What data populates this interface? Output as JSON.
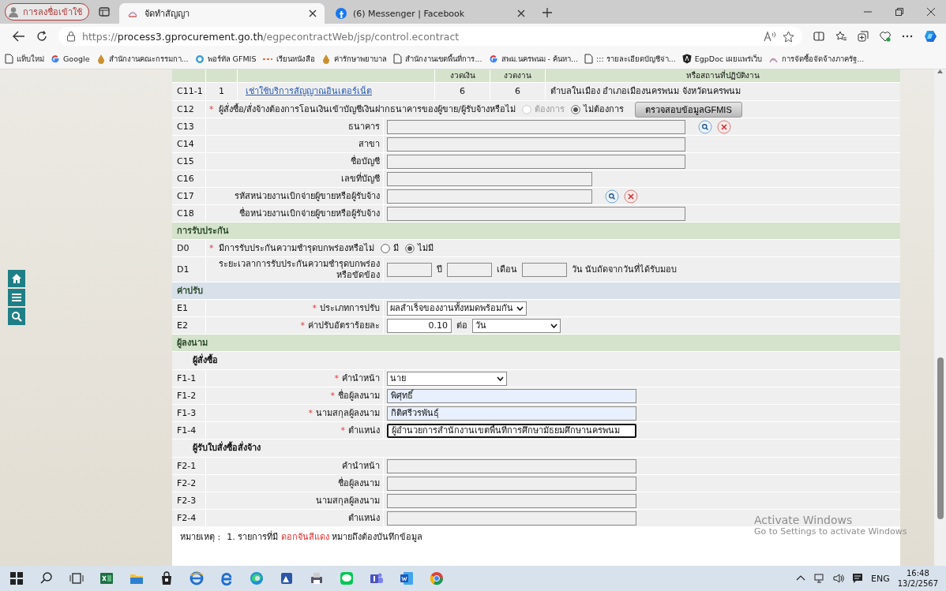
{
  "browser": {
    "profile_button": "การลงชื่อเข้าใช้",
    "tabs": [
      {
        "title": "จัดทำสัญญา",
        "selected": true,
        "kind": "site"
      },
      {
        "title": "(6) Messenger | Facebook",
        "selected": false,
        "kind": "social"
      }
    ],
    "url": {
      "scheme": "https://",
      "host": "process3.gprocurement.go.th",
      "path": "/egpecontractWeb/jsp/control.econtract"
    },
    "bookmarks": [
      {
        "label": "แท็บใหม่",
        "kind": "page"
      },
      {
        "label": "Google",
        "kind": "google"
      },
      {
        "label": "สำนักงานคณะกรรมกา...",
        "kind": "emblem"
      },
      {
        "label": "พอร์ทัล GFMIS",
        "kind": "ring"
      },
      {
        "label": "เรียนหนังสือ",
        "kind": "dash"
      },
      {
        "label": "ค่ารักษาพยาบาล",
        "kind": "emblem"
      },
      {
        "label": "สำนักงานเขตพื้นที่การ...",
        "kind": "page"
      },
      {
        "label": "สพม.นครพนม - ค้นหา...",
        "kind": "google"
      },
      {
        "label": "::: รายละเอียดบัญชีจ่า...",
        "kind": "page"
      },
      {
        "label": "EgpDoc เผยแพร่เว็บ",
        "kind": "shield"
      },
      {
        "label": "การจัดซื้อจัดจ้างภาครัฐ...",
        "kind": "flame"
      }
    ]
  },
  "form": {
    "table_header": [
      "งวดเงิน",
      "งวดงาน",
      "หรือสถานที่ปฏิบัติงาน"
    ],
    "contract_item": {
      "code": "C11-1",
      "number": "1",
      "name": "เช่าใช้บริการสัญญาณอินเตอร์เน็ต",
      "column_4": "6",
      "column_5": "6",
      "location": "ตำบลในเมือง อำเภอเมืองนครพนม จังหวัดนครพนม"
    },
    "rows": [
      {
        "kind": "question",
        "code": "C12",
        "marker": "*",
        "label": "ผู้สั่งซื้อ/สั่งจ้างต้องการโอนเงินเข้าบัญชีเงินฝากธนาคารของผู้ขาย/ผู้รับจ้างหรือไม่",
        "options": [
          {
            "label": "ต้องการ",
            "selected": false,
            "disabled": true
          },
          {
            "label": "ไม่ต้องการ",
            "selected": true,
            "disabled": false
          }
        ],
        "button": "ตรวจสอบข้อมูลGFMIS"
      },
      {
        "kind": "lookup-field",
        "code": "C13",
        "label": "ธนาคาร",
        "autofilled": false,
        "focused": false
      },
      {
        "kind": "field",
        "code": "C14",
        "label": "สาขา",
        "autofilled": false,
        "focused": false
      },
      {
        "kind": "field",
        "code": "C15",
        "label": "ชื่อบัญชี",
        "autofilled": false,
        "focused": false
      },
      {
        "kind": "field",
        "code": "C16",
        "label": "เลขที่บัญชี",
        "autofilled": false,
        "focused": false
      },
      {
        "kind": "lookup-field",
        "code": "C17",
        "label": "รหัสหน่วยงานเบิกจ่ายผู้ขายหรือผู้รับจ้าง",
        "autofilled": false,
        "focused": false
      },
      {
        "kind": "field",
        "code": "C18",
        "label": "ชื่อหน่วยงานเบิกจ่ายผู้ขายหรือผู้รับจ้าง",
        "autofilled": false,
        "focused": false
      },
      {
        "kind": "section",
        "title": "การรับประกัน",
        "color": "#d5e3cc"
      },
      {
        "kind": "radio",
        "code": "D0",
        "marker": "*",
        "label": "มีการรับประกันความชำรุดบกพร่องหรือไม่",
        "options": [
          {
            "label": "มี",
            "selected": false,
            "disabled": false
          },
          {
            "label": "ไม่มี",
            "selected": true,
            "disabled": false
          }
        ]
      },
      {
        "kind": "period",
        "code": "D1",
        "label": "ระยะเวลาการรับประกันความชำรุดบกพร่องหรือขัดข้อง",
        "units": [
          "ปี",
          "เดือน",
          "วัน นับถัดจากวันที่ได้รับมอบ"
        ]
      },
      {
        "kind": "section",
        "title": "ค่าปรับ",
        "color": "#d8e0ea"
      },
      {
        "kind": "select",
        "code": "E1",
        "marker": "*",
        "label": "ประเภทการปรับ",
        "value": "ผลสำเร็จของงานทั้งหมดพร้อมกัน"
      },
      {
        "kind": "rate",
        "code": "E2",
        "marker": "*",
        "label": "ค่าปรับอัตราร้อยละ",
        "value": "0.10",
        "unit": "ต่อ",
        "period": "วัน"
      },
      {
        "kind": "section",
        "title": "ผู้ลงนาม",
        "color": "#d5e3cc"
      },
      {
        "kind": "subheading",
        "title": "ผู้สั่งซื้อ"
      },
      {
        "kind": "select",
        "code": "F1-1",
        "marker": "*",
        "label": "คำนำหน้า",
        "value": "นาย"
      },
      {
        "kind": "field",
        "code": "F1-2",
        "marker": "*",
        "label": "ชื่อผู้ลงนาม",
        "value": "พิศุทธิ์",
        "autofilled": true,
        "focused": false
      },
      {
        "kind": "field",
        "code": "F1-3",
        "marker": "*",
        "label": "นามสกุลผู้ลงนาม",
        "value": "กิติศรีวรพันธุ์",
        "autofilled": true,
        "focused": false
      },
      {
        "kind": "field",
        "code": "F1-4",
        "marker": "*",
        "label": "ตำแหน่ง",
        "value": "ผู้อำนวยการสำนักงานเขตพื้นที่การศึกษามัธยมศึกษานครพนม",
        "autofilled": false,
        "focused": true
      },
      {
        "kind": "subheading",
        "title": "ผู้รับใบสั่งซื้อสั่งจ้าง"
      },
      {
        "kind": "field",
        "code": "F2-1",
        "label": "คำนำหน้า",
        "autofilled": false,
        "focused": false
      },
      {
        "kind": "field",
        "code": "F2-2",
        "label": "ชื่อผู้ลงนาม",
        "autofilled": false,
        "focused": false
      },
      {
        "kind": "field",
        "code": "F2-3",
        "label": "นามสกุลผู้ลงนาม",
        "autofilled": false,
        "focused": false
      },
      {
        "kind": "field",
        "code": "F2-4",
        "label": "ตำแหน่ง",
        "autofilled": false,
        "focused": false
      }
    ],
    "note": {
      "label": "หมายเหตุ :",
      "text": "1. รายการที่มี *ดอกจันสีแดง* หมายถึงต้องบันทึกข้อมูล"
    }
  },
  "activation": {
    "title": "Activate Windows",
    "subtitle": "Go to Settings to activate Windows"
  },
  "taskbar": {
    "language": "ENG",
    "time": "16:48",
    "date": "13/2/2567"
  }
}
